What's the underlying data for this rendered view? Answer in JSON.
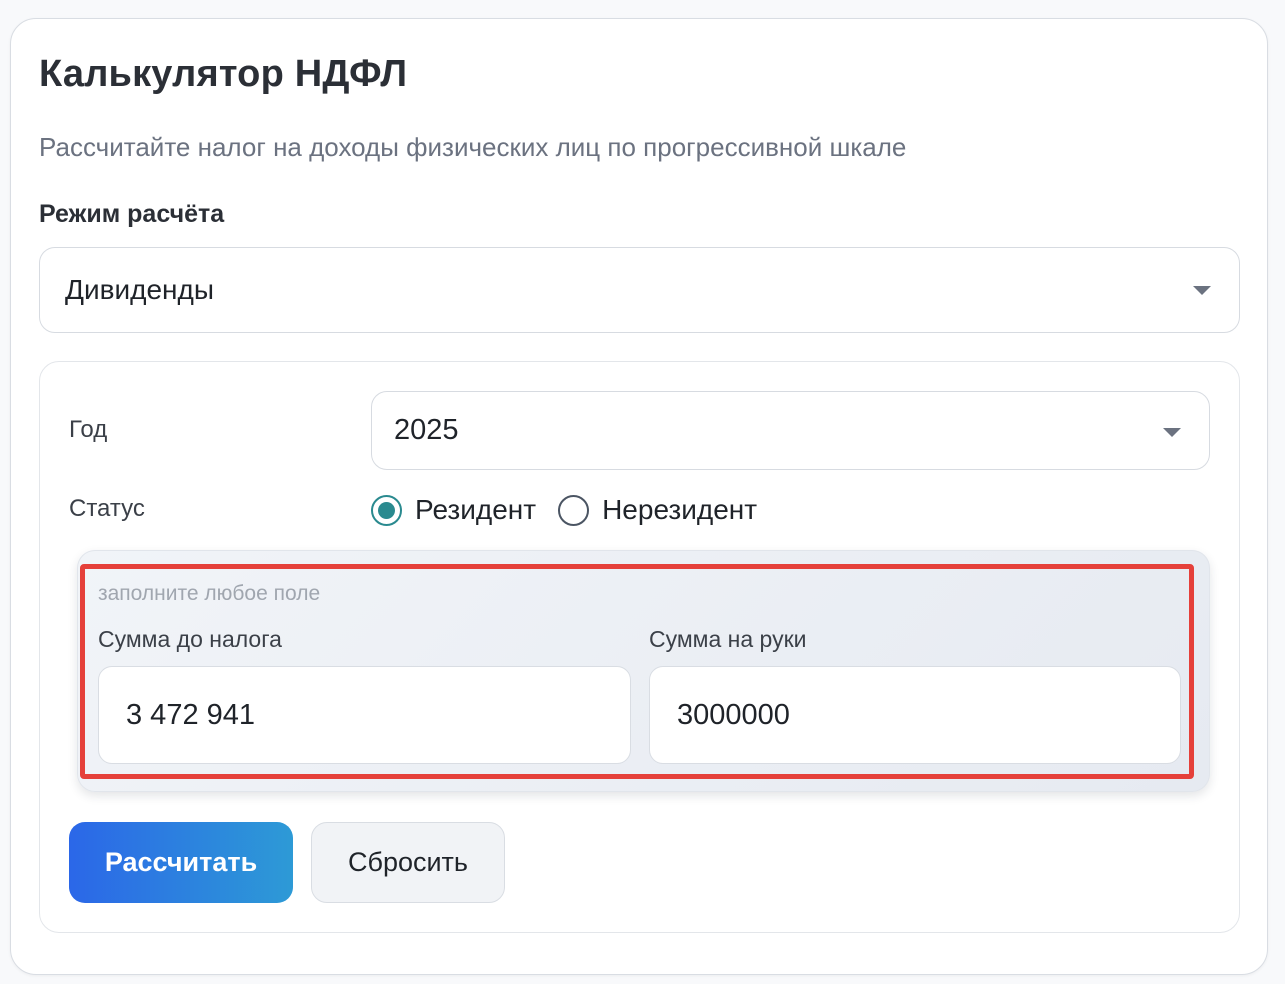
{
  "header": {
    "title": "Калькулятор НДФЛ",
    "subtitle": "Рассчитайте налог на доходы физических лиц по прогрессивной шкале"
  },
  "mode": {
    "label": "Режим расчёта",
    "selected": "Дивиденды"
  },
  "form": {
    "year_label": "Год",
    "year_value": "2025",
    "status_label": "Статус",
    "status_options": [
      {
        "label": "Резидент",
        "checked": true
      },
      {
        "label": "Нерезидент",
        "checked": false
      }
    ],
    "hint": "заполните любое поле",
    "gross_label": "Сумма до налога",
    "gross_value": "3 472 941",
    "net_label": "Сумма на руки",
    "net_value": "3000000"
  },
  "actions": {
    "calculate_label": "Рассчитать",
    "reset_label": "Сбросить"
  },
  "colors": {
    "highlight": "#e5403a",
    "radio_accent": "#2a8a8f",
    "primary_gradient_start": "#2b67e8",
    "primary_gradient_end": "#2d9ad6"
  },
  "icons": {
    "select_caret": "chevron-down-icon"
  }
}
